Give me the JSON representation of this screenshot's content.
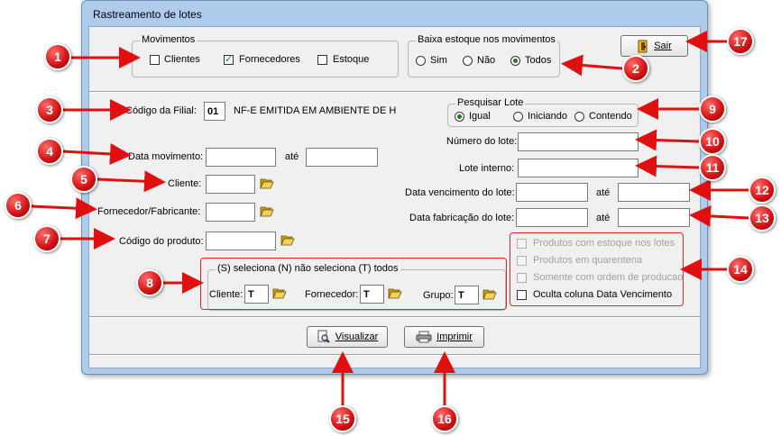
{
  "window": {
    "title": "Rastreamento de lotes"
  },
  "movimentos": {
    "legend": "Movimentos",
    "items": [
      {
        "label": "Clientes",
        "checked": false
      },
      {
        "label": "Fornecedores",
        "checked": true
      },
      {
        "label": "Estoque",
        "checked": false
      }
    ]
  },
  "baixa": {
    "legend": "Baixa estoque nos movimentos",
    "options": [
      {
        "label": "Sim",
        "selected": false
      },
      {
        "label": "Não",
        "selected": false
      },
      {
        "label": "Todos",
        "selected": true
      }
    ]
  },
  "sair_label": "Sair",
  "filial": {
    "label": "Código da Filial:",
    "value": "01",
    "description": "NF-E EMITIDA EM AMBIENTE DE H"
  },
  "pesquisar": {
    "legend": "Pesquisar Lote",
    "options": [
      {
        "label": "Igual",
        "selected": true
      },
      {
        "label": "Iniciando",
        "selected": false
      },
      {
        "label": "Contendo",
        "selected": false
      }
    ]
  },
  "fields": {
    "data_movimento": "Data movimento:",
    "ate": "até",
    "cliente": "Cliente:",
    "fornecedor": "Fornecedor/Fabricante:",
    "codigo_produto": "Código do produto:",
    "numero_lote": "Número do lote:",
    "lote_interno": "Lote interno:",
    "data_vencimento": "Data vencimento do lote:",
    "data_fabricacao": "Data fabricação do lote:"
  },
  "selecao": {
    "legend": "(S) seleciona  (N) não seleciona  (T) todos",
    "cliente_label": "Cliente:",
    "cliente_value": "T",
    "fornecedor_label": "Fornecedor:",
    "fornecedor_value": "T",
    "grupo_label": "Grupo:",
    "grupo_value": "T"
  },
  "options": [
    {
      "label": "Produtos com estoque nos lotes",
      "enabled": false
    },
    {
      "label": "Produtos em quarentena",
      "enabled": false
    },
    {
      "label": "Somente com ordem de producao",
      "enabled": false
    },
    {
      "label": "Oculta coluna Data Vencimento",
      "enabled": true
    }
  ],
  "visualizar_label": "Visualizar",
  "imprimir_label": "Imprimir",
  "markers": [
    "1",
    "2",
    "3",
    "4",
    "5",
    "6",
    "7",
    "8",
    "9",
    "10",
    "11",
    "12",
    "13",
    "14",
    "15",
    "16",
    "17"
  ],
  "colors": {
    "annotation": "#e01010",
    "window_frame": "#aecbec",
    "check_green": "#1b7d1b"
  },
  "icons": {
    "sair": "exit-door-icon",
    "visualizar": "magnifier-document-icon",
    "imprimir": "printer-icon",
    "lookup": "open-folder-icon"
  }
}
